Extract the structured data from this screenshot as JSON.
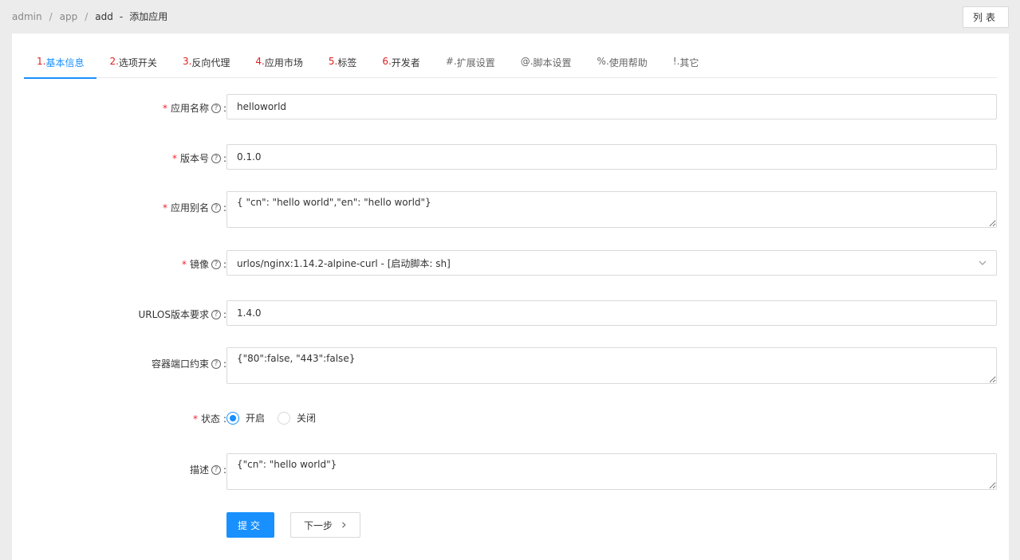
{
  "breadcrumb": {
    "items": [
      "admin",
      "app",
      "add"
    ],
    "title": "添加应用"
  },
  "header": {
    "list_button": "列表"
  },
  "tabs": [
    {
      "num": "1.",
      "label": "基本信息",
      "active": true
    },
    {
      "num": "2.",
      "label": "选项开关"
    },
    {
      "num": "3.",
      "label": "反向代理"
    },
    {
      "num": "4.",
      "label": "应用市场"
    },
    {
      "num": "5.",
      "label": "标签"
    },
    {
      "num": "6.",
      "label": "开发者"
    },
    {
      "num": "#.",
      "label": "扩展设置"
    },
    {
      "num": "@.",
      "label": "脚本设置"
    },
    {
      "num": "%.",
      "label": "使用帮助"
    },
    {
      "num": "!.",
      "label": "其它"
    }
  ],
  "form": {
    "app_name": {
      "label": "应用名称",
      "value": "helloworld",
      "required": true
    },
    "version": {
      "label": "版本号",
      "value": "0.1.0",
      "required": true
    },
    "alias": {
      "label": "应用别名",
      "value": "{ \"cn\": \"hello world\",\"en\": \"hello world\"}",
      "required": true
    },
    "image": {
      "label": "镜像",
      "value": "urlos/nginx:1.14.2-alpine-curl - [启动脚本: sh]",
      "required": true
    },
    "urlos_version": {
      "label": "URLOS版本要求",
      "value": "1.4.0"
    },
    "port_constraint": {
      "label": "容器端口约束",
      "value": "{\"80\":false, \"443\":false}"
    },
    "status": {
      "label": "状态",
      "required": true,
      "options": [
        "开启",
        "关闭"
      ],
      "selected": "开启"
    },
    "description": {
      "label": "描述",
      "value": "{\"cn\": \"hello world\"}"
    }
  },
  "actions": {
    "submit": "提交",
    "next": "下一步"
  },
  "colors": {
    "accent": "#1890ff",
    "required": "#f5222d",
    "tab_number": "#e02020"
  }
}
